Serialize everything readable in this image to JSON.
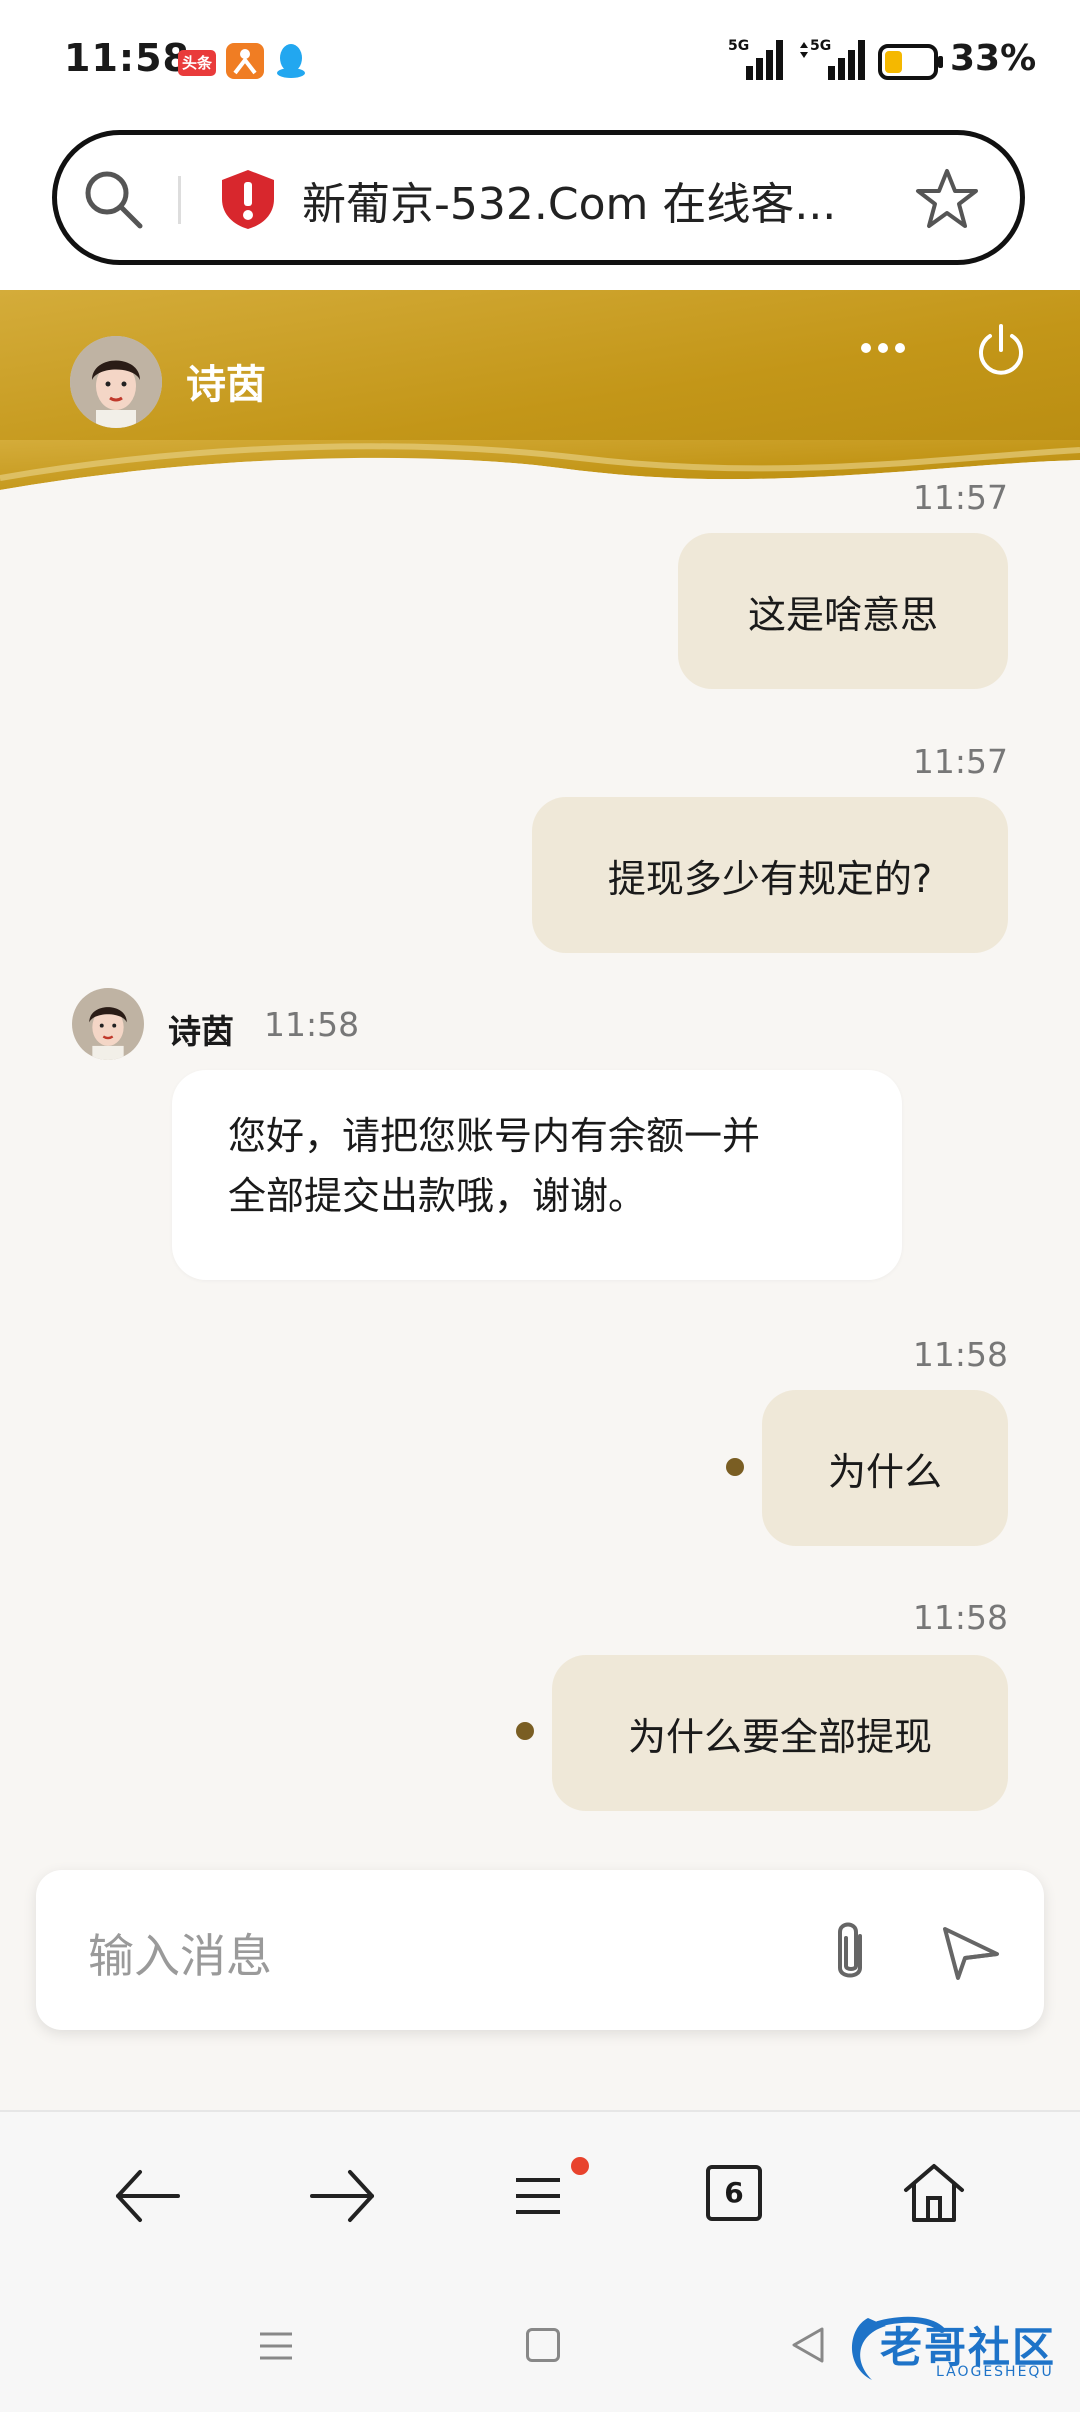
{
  "status_bar": {
    "time": "11:58",
    "battery_percent": "33%",
    "battery_level": 0.33,
    "signal_1_label": "5G",
    "signal_2_label": "5G",
    "apps": [
      "toutiao-icon",
      "app-orange-icon",
      "qq-icon"
    ],
    "toutiao_label": "头条"
  },
  "browser": {
    "url_title": "新葡京-532.Com 在线客...",
    "tab_count": "6"
  },
  "chat": {
    "agent_name": "诗茵",
    "messages": [
      {
        "direction": "out",
        "time": "11:57",
        "text": "这是啥意思"
      },
      {
        "direction": "out",
        "time": "11:57",
        "text": "提现多少有规定的?"
      },
      {
        "direction": "in",
        "sender": "诗茵",
        "time": "11:58",
        "line1": "您好，请把您账号内有余额一并",
        "line2": "全部提交出款哦，谢谢。"
      },
      {
        "direction": "out",
        "time": "11:58",
        "text": "为什么"
      },
      {
        "direction": "out",
        "time": "11:58",
        "text": "为什么要全部提现"
      }
    ]
  },
  "input": {
    "placeholder": "输入消息"
  },
  "watermark": {
    "text": "老哥社区",
    "subtext": "LAOGESHEQU"
  },
  "colors": {
    "header_gold": "#c9a033",
    "bubble_out": "#efe8d8",
    "bubble_in": "#ffffff",
    "status_dot": "#7a5e23",
    "background": "#f8f6f3"
  }
}
